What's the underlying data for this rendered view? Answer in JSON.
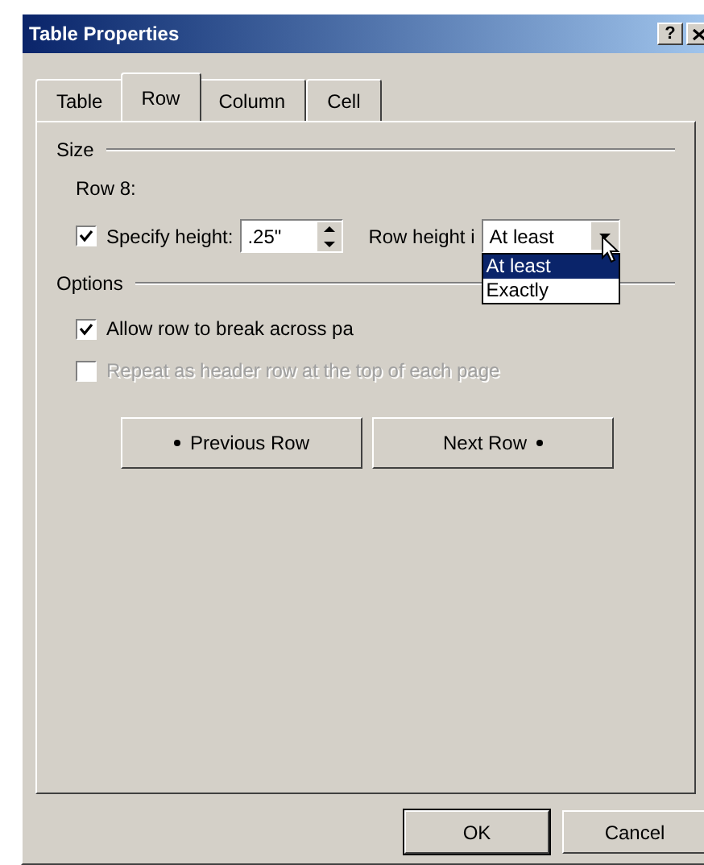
{
  "window": {
    "title": "Table Properties",
    "help_button": "?"
  },
  "tabs": [
    {
      "label": "Table",
      "selected": false
    },
    {
      "label": "Row",
      "selected": true
    },
    {
      "label": "Column",
      "selected": false
    },
    {
      "label": "Cell",
      "selected": false
    }
  ],
  "size_group": {
    "label": "Size",
    "row_label": "Row 8:",
    "specify_height": {
      "label": "Specify height:",
      "checked": true
    },
    "height_value": ".25\"",
    "row_height_label": "Row height i",
    "row_height_value": "At least",
    "dropdown_options": [
      {
        "label": "At least",
        "selected": true
      },
      {
        "label": "Exactly",
        "selected": false
      }
    ]
  },
  "options_group": {
    "label": "Options",
    "checkboxes": [
      {
        "label": "Allow row to break across pa",
        "checked": true,
        "disabled": false
      },
      {
        "label": "Repeat as header row at the top of each page",
        "checked": false,
        "disabled": true
      }
    ]
  },
  "nav_buttons": [
    {
      "label": "Previous Row",
      "kind": "previous"
    },
    {
      "label": "Next Row",
      "kind": "next"
    }
  ],
  "buttons": [
    "OK",
    "Cancel"
  ]
}
